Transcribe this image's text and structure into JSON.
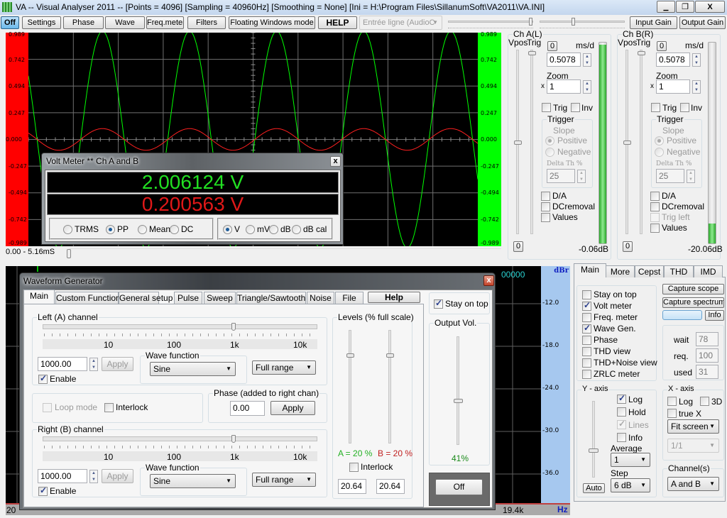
{
  "window": {
    "title": "VA -- Visual Analyser 2011 --  [Points = 4096]  [Sampling = 40960Hz]  [Smoothing = None]  [Ini = H:\\Program Files\\SillanumSoft\\VA2011\\VA.INI]",
    "minimize": "▁",
    "restore": "❐",
    "close": "X"
  },
  "toolbar": {
    "off": "Off",
    "settings": "Settings",
    "phase": "Phase",
    "wave": "Wave",
    "freq_meter": "Freq.meter",
    "filters": "Filters",
    "floating": "Floating Windows mode",
    "help": "HELP",
    "input_device": "Entrée ligne (AudioC",
    "input_gain": "Input Gain",
    "output_gain": "Output Gain"
  },
  "scope": {
    "time_range": "0.00 - 5.16mS",
    "colors": {
      "left_bar": "#ff0000",
      "right_bar": "#00ff00",
      "ch_a": "#00ff00",
      "ch_b": "#ff2020",
      "grid": "#808080",
      "background": "#000000"
    }
  },
  "chart_data": {
    "type": "line",
    "x_unit": "ms",
    "xlim": [
      0,
      5.16
    ],
    "ylim": [
      -0.989,
      0.989
    ],
    "y_ticks": [
      "0.989",
      "0.742",
      "0.494",
      "0.247",
      "0.000",
      "-0.247",
      "-0.494",
      "-0.742",
      "-0.989"
    ],
    "grid": true,
    "series": [
      {
        "name": "Ch A(L)",
        "waveform": "sine",
        "frequency_hz": 1000,
        "peak_to_peak_v": 2.006124,
        "color": "#00ff00"
      },
      {
        "name": "Ch B(R)",
        "waveform": "sine",
        "frequency_hz": 1000,
        "peak_to_peak_v": 0.200563,
        "color": "#ff2020"
      }
    ]
  },
  "volt_meter": {
    "title": "Volt Meter ** Ch A and B",
    "close": "x",
    "ch_a_value": "2.006124 V",
    "ch_b_value": "0.200563 V",
    "modes": [
      {
        "label": "TRMS",
        "checked": false
      },
      {
        "label": "PP",
        "checked": true
      },
      {
        "label": "Mean",
        "checked": false
      },
      {
        "label": "DC",
        "checked": false
      }
    ],
    "units": [
      {
        "label": "V",
        "checked": true
      },
      {
        "label": "mV",
        "checked": false
      },
      {
        "label": "dB",
        "checked": false
      },
      {
        "label": "dB cal",
        "checked": false
      }
    ]
  },
  "channels": [
    {
      "title": "Ch A(L)",
      "vpos": "Vpos",
      "trig": "Trig",
      "zero_top": "0",
      "ms_div_label": "ms/d",
      "ms_div": "0.5078",
      "zoom_label": "Zoom",
      "zoom_x": "x",
      "zoom": "1",
      "trig_cb": {
        "label": "Trig",
        "checked": false
      },
      "inv_cb": {
        "label": "Inv",
        "checked": false
      },
      "trigger": "Trigger",
      "slope": "Slope",
      "positive": {
        "label": "Positive",
        "checked": true
      },
      "negative": {
        "label": "Negative",
        "checked": false
      },
      "delta_label": "Delta Th %",
      "delta": "25",
      "da": {
        "label": "D/A",
        "checked": false
      },
      "dcremoval": {
        "label": "DCremoval",
        "checked": false
      },
      "values": {
        "label": "Values",
        "checked": false
      },
      "zero_bottom": "0",
      "level_db": "-0.06dB",
      "level_fraction": 0.99
    },
    {
      "title": "Ch B(R)",
      "vpos": "Vpos",
      "trig": "Trig",
      "zero_top": "0",
      "ms_div_label": "ms/d",
      "ms_div": "0.5078",
      "zoom_label": "Zoom",
      "zoom_x": "x",
      "zoom": "1",
      "trig_cb": {
        "label": "Trig",
        "checked": false
      },
      "inv_cb": {
        "label": "Inv",
        "checked": false
      },
      "trigger": "Trigger",
      "slope": "Slope",
      "positive": {
        "label": "Positive",
        "checked": true
      },
      "negative": {
        "label": "Negative",
        "checked": false
      },
      "delta_label": "Delta Th %",
      "delta": "25",
      "da": {
        "label": "D/A",
        "checked": false
      },
      "dcremoval": {
        "label": "DCremoval",
        "checked": false
      },
      "trig_left": {
        "label": "Trig left",
        "checked": false
      },
      "values": {
        "label": "Values",
        "checked": false
      },
      "zero_bottom": "0",
      "level_db": "-20.06dB",
      "level_fraction": 0.1
    }
  ],
  "spectrum": {
    "readout": "00000",
    "unit_y": "dBr",
    "db_ticks": [
      "-12.0",
      "-18.0",
      "-24.0",
      "-30.0",
      "-36.0"
    ],
    "x_start": "20",
    "x_end": "19.4k",
    "unit_x": "Hz"
  },
  "wavegen": {
    "title": "Waveform Generator",
    "close": "x",
    "tabs": [
      "Main",
      "Custom Function",
      "General setup",
      "Pulse",
      "Sweep",
      "Triangle/Sawtooth",
      "Noise",
      "File"
    ],
    "help": "Help",
    "freq_labels": [
      "10",
      "100",
      "1k",
      "10k"
    ],
    "left": {
      "title": "Left (A) channel",
      "freq": "1000.00",
      "apply": "Apply",
      "enable": {
        "label": "Enable",
        "checked": true
      },
      "wave_fn_label": "Wave function",
      "wave_fn": "Sine",
      "range": "Full range"
    },
    "right": {
      "title": "Right (B) channel",
      "freq": "1000.00",
      "apply": "Apply",
      "enable": {
        "label": "Enable",
        "checked": true
      },
      "wave_fn_label": "Wave function",
      "wave_fn": "Sine",
      "range": "Full range"
    },
    "loop_mode": {
      "label": "Loop mode",
      "checked": false
    },
    "interlock": {
      "label": "Interlock",
      "checked": false
    },
    "phase": {
      "title": "Phase (added to right chan)",
      "value": "0.00",
      "apply": "Apply"
    },
    "levels": {
      "title": "Levels (% full scale)",
      "a_label": "A = 20 %",
      "b_label": "B = 20 %",
      "a_percent": 20,
      "b_percent": 20,
      "interlock": {
        "label": "Interlock",
        "checked": false
      },
      "a_value": "20.64",
      "b_value": "20.64"
    },
    "stay_on_top": {
      "label": "Stay on top",
      "checked": true
    },
    "output_vol": {
      "title": "Output Vol.",
      "label": "41%",
      "percent": 41
    },
    "off": "Off"
  },
  "side": {
    "tabs": [
      "Main",
      "More",
      "Cepst",
      "THD",
      "IMD"
    ],
    "checks": [
      {
        "label": "Stay on top",
        "checked": false
      },
      {
        "label": "Volt meter",
        "checked": true
      },
      {
        "label": "Freq. meter",
        "checked": false
      },
      {
        "label": "Wave Gen.",
        "checked": true
      },
      {
        "label": "Phase",
        "checked": false
      },
      {
        "label": "THD view",
        "checked": false
      },
      {
        "label": "THD+Noise view",
        "checked": false
      },
      {
        "label": "ZRLC meter",
        "checked": false
      }
    ],
    "capture_scope": "Capture scope",
    "capture_spectrum": "Capture spectrum",
    "info": "Info",
    "wait_label": "wait",
    "wait": "78",
    "req_label": "req.",
    "req": "100",
    "used_label": "used",
    "used": "31",
    "y_axis": {
      "title": "Y - axis",
      "log": {
        "label": "Log",
        "checked": true
      },
      "hold": {
        "label": "Hold",
        "checked": false
      },
      "lines": {
        "label": "Lines",
        "checked": true
      },
      "info": {
        "label": "Info",
        "checked": false
      },
      "average_label": "Average",
      "average": "1",
      "step_label": "Step",
      "step": "6 dB",
      "auto": "Auto"
    },
    "x_axis": {
      "title": "X - axis",
      "log": {
        "label": "Log",
        "checked": false
      },
      "d3": {
        "label": "3D",
        "checked": false
      },
      "true_x": {
        "label": "true X",
        "checked": false
      },
      "fit": "Fit screen",
      "ratio": "1/1"
    },
    "channels_title": "Channel(s)",
    "channels": "A and B"
  }
}
